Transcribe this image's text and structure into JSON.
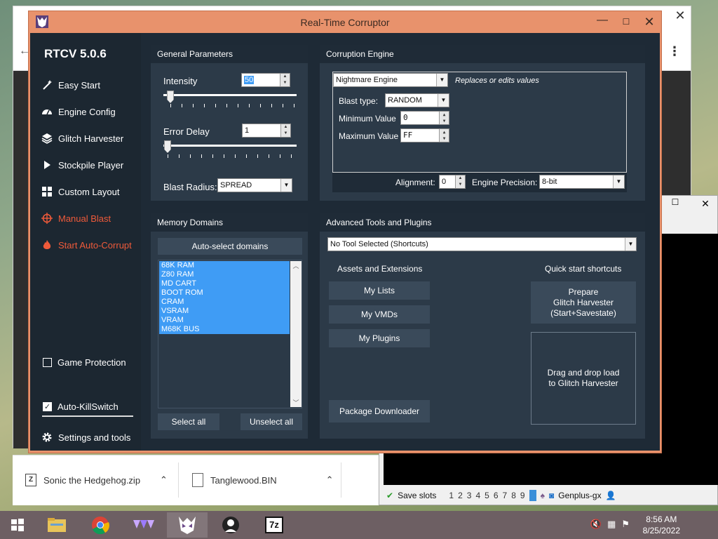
{
  "colors": {
    "rtc_frame": "#e8926c",
    "rtc_bg": "#1e2a36",
    "panel_bg": "#2c3a48",
    "accent_red": "#ef5a3a",
    "selection_blue": "#3f9cf5"
  },
  "rtc": {
    "window_title": "Real-Time Corruptor",
    "app_title": "RTCV 5.0.6",
    "sidebar": {
      "items": [
        {
          "label": "Easy Start",
          "icon": "wand-icon"
        },
        {
          "label": "Engine Config",
          "icon": "gauge-icon"
        },
        {
          "label": "Glitch Harvester",
          "icon": "layers-icon"
        },
        {
          "label": "Stockpile Player",
          "icon": "play-icon"
        },
        {
          "label": "Custom Layout",
          "icon": "grid-icon"
        },
        {
          "label": "Manual Blast",
          "icon": "crosshair-icon"
        },
        {
          "label": "Start Auto-Corrupt",
          "icon": "flame-icon"
        }
      ],
      "game_protection": {
        "label": "Game Protection",
        "checked": false
      },
      "auto_killswitch": {
        "label": "Auto-KillSwitch",
        "checked": true
      },
      "settings": {
        "label": "Settings and tools",
        "icon": "gear-icon"
      }
    },
    "general": {
      "heading": "General Parameters",
      "intensity_label": "Intensity",
      "intensity_value": "50",
      "error_delay_label": "Error Delay",
      "error_delay_value": "1",
      "blast_radius_label": "Blast Radius:",
      "blast_radius_value": "SPREAD"
    },
    "engine": {
      "heading": "Corruption Engine",
      "engine_value": "Nightmare Engine",
      "engine_hint": "Replaces or edits values",
      "blast_type_label": "Blast type:",
      "blast_type_value": "RANDOM",
      "min_label": "Minimum Value",
      "min_value": "0",
      "max_label": "Maximum Value",
      "max_value": "FF",
      "alignment_label": "Alignment:",
      "alignment_value": "0",
      "precision_label": "Engine Precision:",
      "precision_value": "8-bit"
    },
    "memory": {
      "heading": "Memory Domains",
      "auto_select": "Auto-select domains",
      "domains": [
        "68K RAM",
        "Z80 RAM",
        "MD CART",
        "BOOT ROM",
        "CRAM",
        "VSRAM",
        "VRAM",
        "M68K BUS"
      ],
      "select_all": "Select all",
      "unselect_all": "Unselect all"
    },
    "advanced": {
      "heading": "Advanced Tools and Plugins",
      "tool_value": "No Tool Selected (Shortcuts)",
      "assets_heading": "Assets and Extensions",
      "my_lists": "My Lists",
      "my_vmds": "My VMDs",
      "my_plugins": "My Plugins",
      "package_downloader": "Package Downloader",
      "quick_heading": "Quick start shortcuts",
      "prepare_line1": "Prepare",
      "prepare_line2": "Glitch Harvester",
      "prepare_line3": "(Start+Savestate)",
      "drop_line1": "Drag and drop load",
      "drop_line2": "to Glitch Harvester"
    }
  },
  "downloads": [
    {
      "name": "Sonic the Hedgehog.zip"
    },
    {
      "name": "Tanglewood.BIN"
    }
  ],
  "emulator": {
    "save_slots_label": "Save slots",
    "slots": [
      "1",
      "2",
      "3",
      "4",
      "5",
      "6",
      "7",
      "8",
      "9"
    ],
    "app_name": "Genplus-gx"
  },
  "taskbar": {
    "time": "8:56 AM",
    "date": "8/25/2022"
  }
}
